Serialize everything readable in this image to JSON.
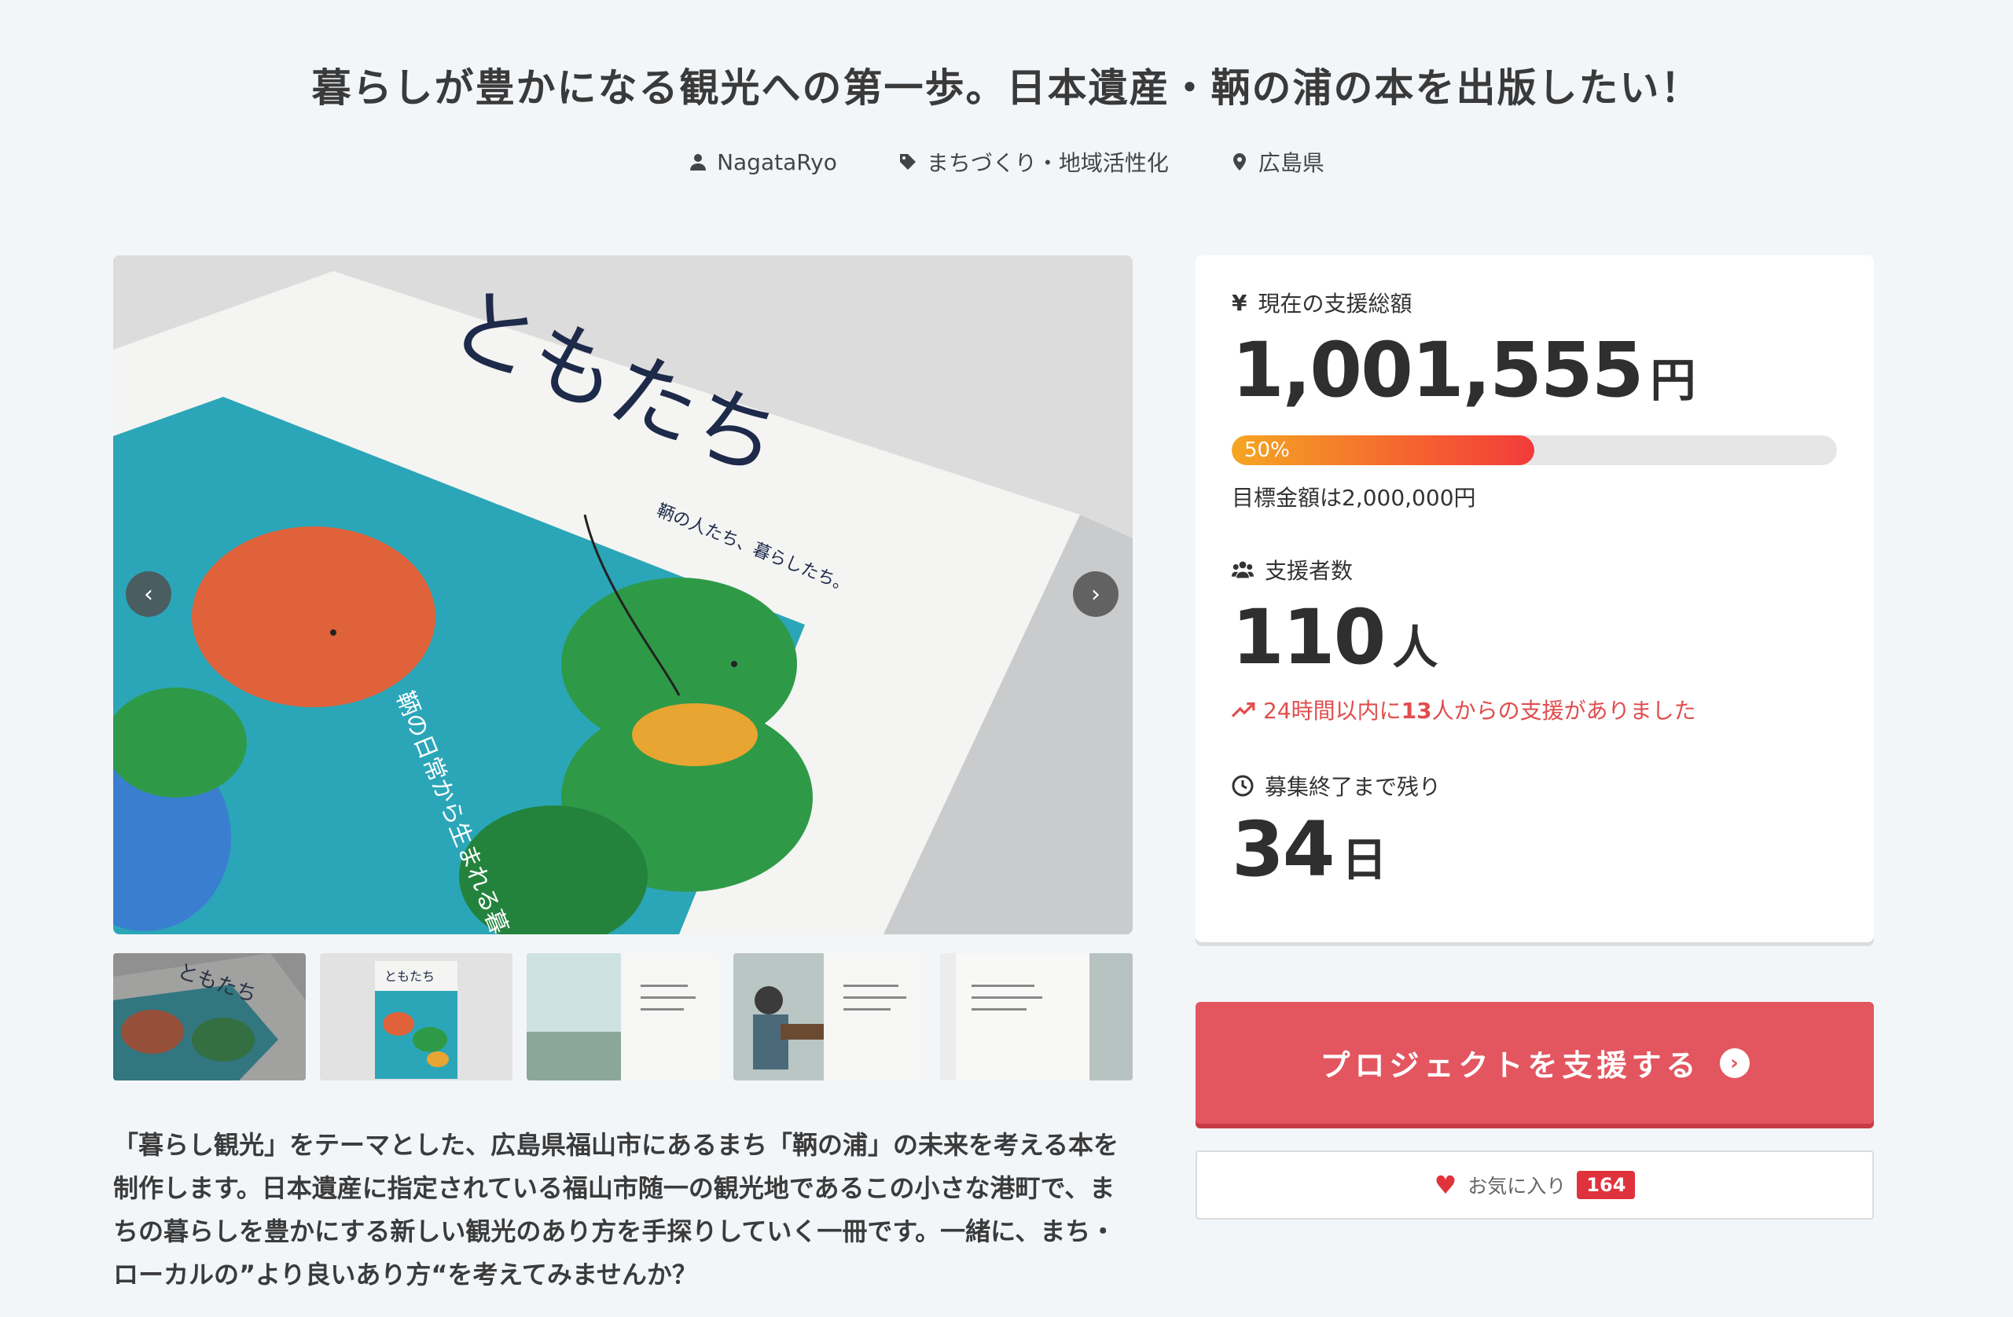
{
  "project": {
    "title": "暮らしが豊かになる観光への第一歩。日本遺産・鞆の浦の本を出版したい！",
    "author": "NagataRyo",
    "category": "まちづくり・地域活性化",
    "location": "広島県"
  },
  "gallery": {
    "book_title": "ともたち",
    "book_tagline": "鞆の人たち、暮らしたち。",
    "book_cover_text": "鞆の日常から生まれる暮らし観光。",
    "thumbnail_count": 5
  },
  "stats": {
    "total_label": "現在の支援総額",
    "total_amount": "1,001,555",
    "total_unit": "円",
    "progress_percent": 50,
    "progress_label": "50%",
    "goal_text": "目標金額は2,000,000円",
    "supporters_label": "支援者数",
    "supporters_count": "110",
    "supporters_unit": "人",
    "recent_prefix": "24時間以内に",
    "recent_count": "13",
    "recent_suffix": "人からの支援がありました",
    "remaining_label": "募集終了まで残り",
    "remaining_days": "34",
    "remaining_unit": "日"
  },
  "actions": {
    "support_label": "プロジェクトを支援する",
    "favorite_label": "お気に入り",
    "favorite_count": "164"
  },
  "description": "「暮らし観光」をテーマとした、広島県福山市にあるまち「鞆の浦」の未来を考える本を制作します。日本遺産に指定されている福山市随一の観光地であるこの小さな港町で、まちの暮らしを豊かにする新しい観光のあり方を手探りしていく一冊です。一緒に、まち・ローカルの”より良いあり方“を考えてみませんか？",
  "colors": {
    "accent": "#e35660",
    "alert": "#e14d4d",
    "book_teal": "#2ba6b8",
    "book_green": "#2e9a48",
    "book_orange": "#e0623a"
  }
}
